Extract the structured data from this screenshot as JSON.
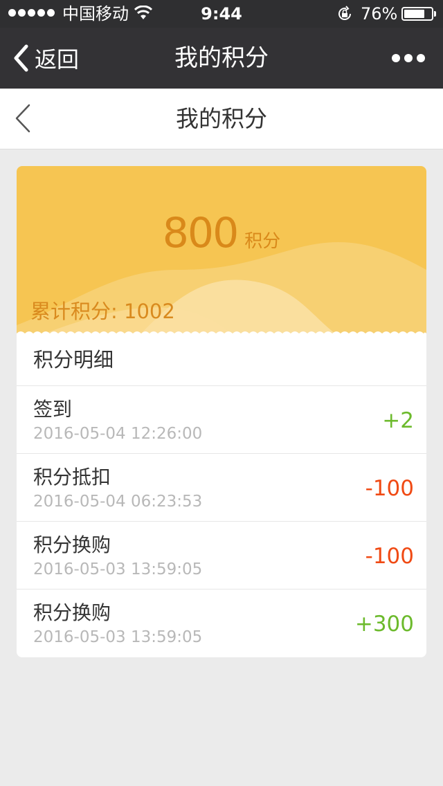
{
  "status_bar": {
    "carrier": "中国移动",
    "time": "9:44",
    "battery_percent": "76%",
    "battery_level": 0.76,
    "signal_bars": 5
  },
  "nav_bar": {
    "back_label": "返回",
    "title": "我的积分",
    "more_icon": "more-dots-icon"
  },
  "page_header": {
    "title": "我的积分",
    "back_icon": "chevron-left-icon"
  },
  "points": {
    "value": "800",
    "unit": "积分",
    "total_label": "累计积分:",
    "total_value": "1002"
  },
  "details": {
    "title": "积分明细",
    "records": [
      {
        "title": "签到",
        "time": "2016-05-04 12:26:00",
        "amount": "+2",
        "type": "pos"
      },
      {
        "title": "积分抵扣",
        "time": "2016-05-04 06:23:53",
        "amount": "-100",
        "type": "neg"
      },
      {
        "title": "积分换购",
        "time": "2016-05-03 13:59:05",
        "amount": "-100",
        "type": "neg"
      },
      {
        "title": "积分换购",
        "time": "2016-05-03 13:59:05",
        "amount": "+300",
        "type": "pos"
      }
    ]
  },
  "colors": {
    "banner": "#f6c552",
    "accent_text": "#d9891a",
    "positive": "#6cba2c",
    "negative": "#f04a14",
    "nav_bg": "#333235"
  }
}
